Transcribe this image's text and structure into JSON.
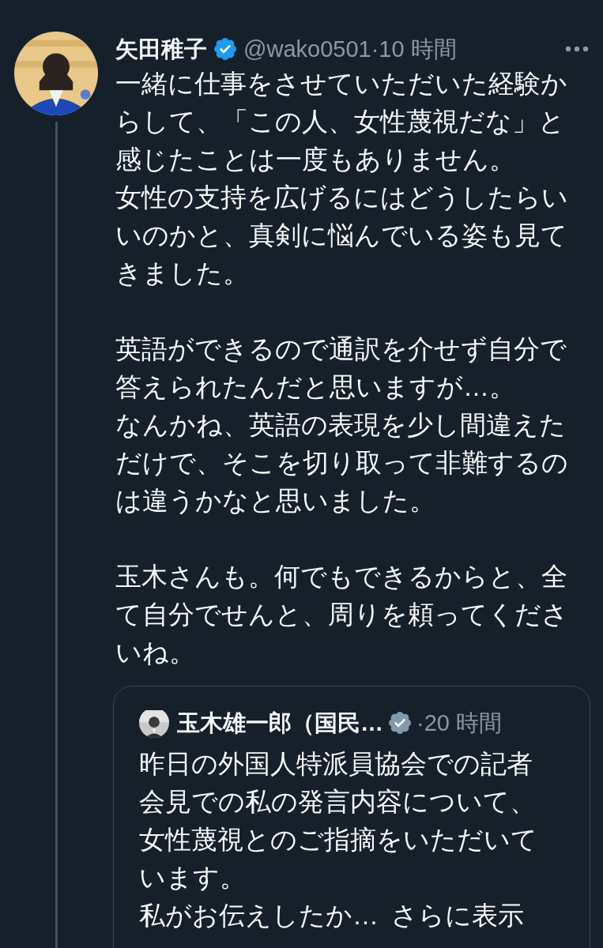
{
  "tweet": {
    "author": {
      "name": "矢田稚子",
      "handle": "@wako0501",
      "badge": {
        "color": "#1d9bf0"
      }
    },
    "separator": "·",
    "time": "10 時間",
    "paragraphs": [
      [
        "一緒に仕事をさせていただいた経験からして、「この人、女性蔑視だな」と感じたことは一度もありません。",
        "女性の支持を広げるにはどうしたらいいのかと、真剣に悩んでいる姿も見てきました。"
      ],
      [
        "英語ができるので通訳を介せず自分で答えられたんだと思いますが…。",
        "なんかね、英語の表現を少し間違えただけで、そこを切り取って非難するのは違うかなと思いました。"
      ],
      [
        "玉木さんも。何でもできるからと、全て自分でせんと、周りを頼ってくださいね。"
      ]
    ],
    "thread_line": true,
    "quote": {
      "author": {
        "name": "玉木雄一郎（国民…",
        "badge": {
          "color": "#829aab"
        }
      },
      "separator": "·",
      "time": "20 時間",
      "lines": [
        "昨日の外国人特派員協会での記者会見での私の発言内容について、女性蔑視とのご指摘をいただいています。",
        "私がお伝えしたか…"
      ],
      "more_link": "さらに表示"
    }
  }
}
